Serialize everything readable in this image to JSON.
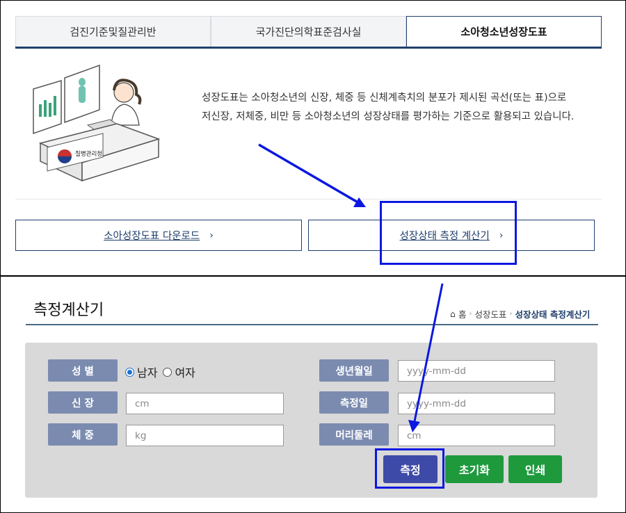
{
  "tabs": [
    {
      "label": "검진기준및질관리반",
      "active": false
    },
    {
      "label": "국가진단의학표준검사실",
      "active": false
    },
    {
      "label": "소아청소년성장도표",
      "active": true
    }
  ],
  "illustration": {
    "sign_text": "질병관리청",
    "icon": "operator-at-desk-illustration"
  },
  "description": {
    "line1": "성장도표는 소아청소년의 신장, 체중 등 신체계측치의 분포가 제시된 곡선(또는 표)으로",
    "line2": "저신장, 저체중, 비만 등 소아청소년의 성장상태를 평가하는 기준으로 활용되고 있습니다."
  },
  "links": {
    "download": "소아성장도표 다운로드",
    "calculator": "성장상태 측정 계산기",
    "chevron": "›"
  },
  "calculator": {
    "title": "측정계산기",
    "breadcrumb": {
      "home": "홈",
      "section": "성장도표",
      "current": "성장상태 측정계산기"
    },
    "labels": {
      "sex": "성 별",
      "height": "신 장",
      "weight": "체 중",
      "birth_date": "생년월일",
      "measure_date": "측정일",
      "head_circ": "머리둘레"
    },
    "sex_options": [
      {
        "label": "남자",
        "selected": true
      },
      {
        "label": "여자",
        "selected": false
      }
    ],
    "placeholders": {
      "height": "cm",
      "weight": "kg",
      "birth_date": "yyyy-mm-dd",
      "measure_date": "yyyy-mm-dd",
      "head_circ": "cm"
    },
    "buttons": {
      "measure": "측정",
      "reset": "초기화",
      "print": "인쇄"
    }
  },
  "colors": {
    "navy": "#1f3f6b",
    "label_bg": "#7b8bb0",
    "green": "#1e9a3d",
    "measure_btn": "#3e4aa8",
    "annotation": "#0b18e0"
  }
}
